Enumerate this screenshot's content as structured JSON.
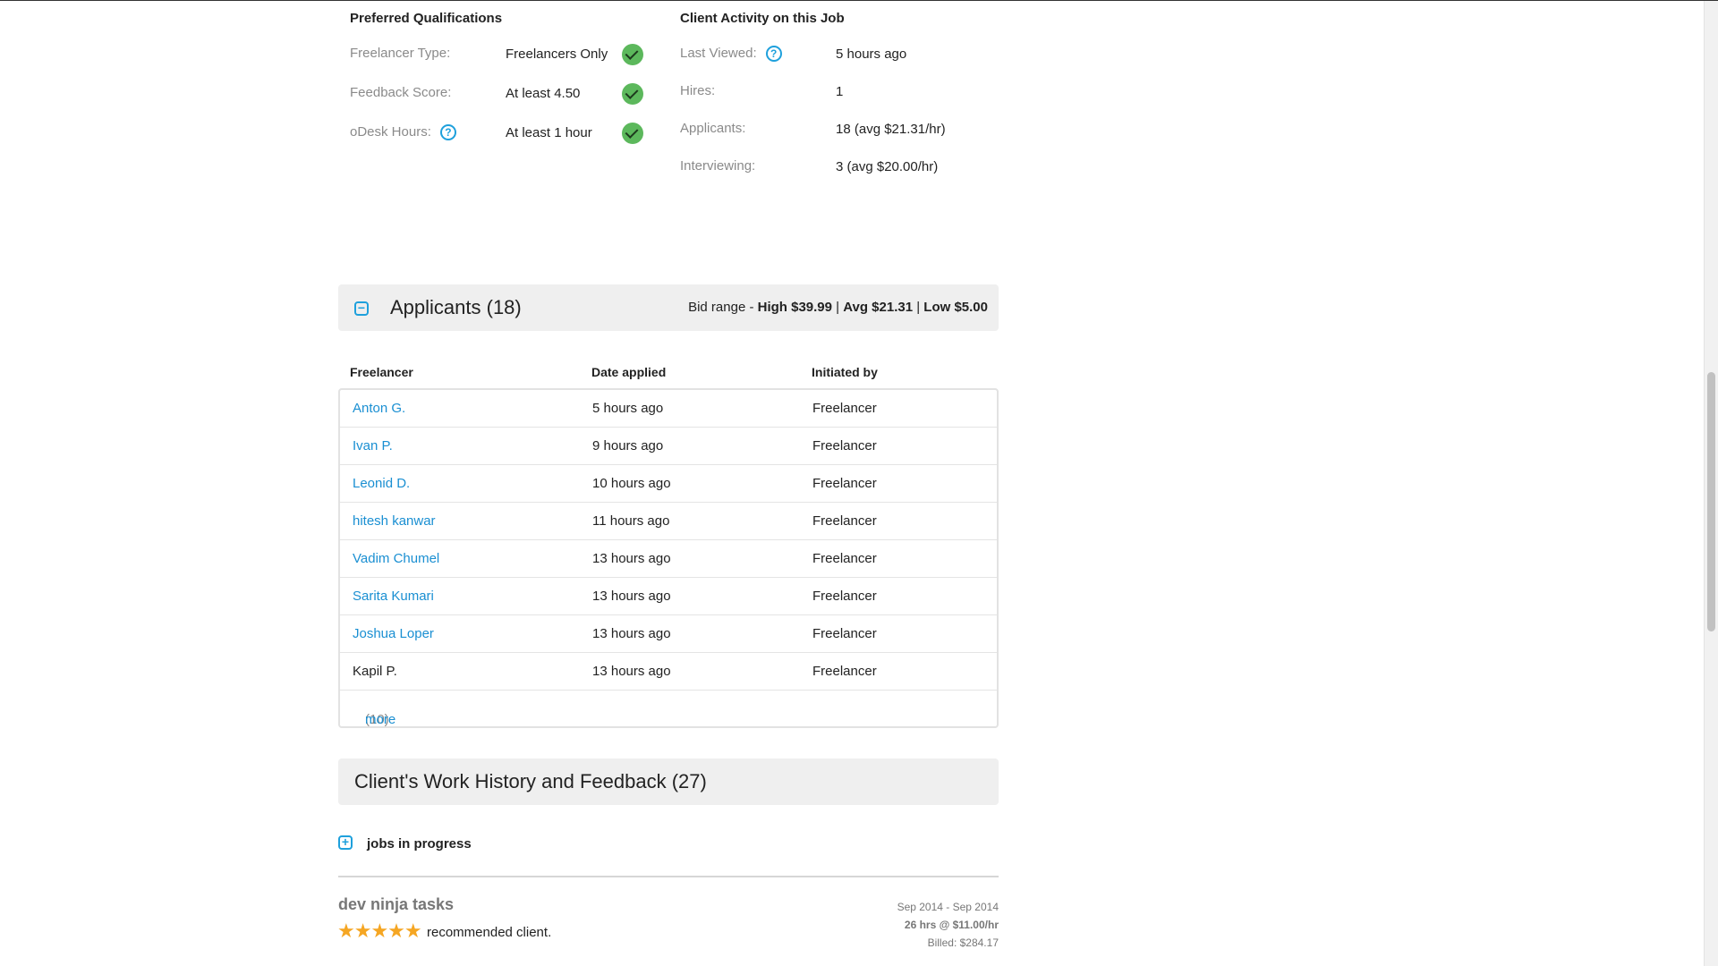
{
  "qualifications": {
    "heading": "Preferred Qualifications",
    "rows": [
      {
        "label": "Freelancer Type:",
        "value": "Freelancers Only",
        "met": true
      },
      {
        "label": "Feedback Score:",
        "value": "At least 4.50",
        "met": true
      },
      {
        "label": "oDesk Hours:",
        "value": "At least 1 hour",
        "met": true
      }
    ]
  },
  "activity": {
    "heading": "Client Activity on this Job",
    "rows": [
      {
        "label": "Last Viewed:",
        "value": "5 hours ago"
      },
      {
        "label": "Hires:",
        "value": "1"
      },
      {
        "label": "Applicants:",
        "value": "18 (avg $21.31/hr)"
      },
      {
        "label": "Interviewing:",
        "value": "3 (avg $20.00/hr)"
      }
    ]
  },
  "applicants": {
    "toggle_glyph": "−",
    "title": "Applicants (18)",
    "bid_prefix": "Bid range - ",
    "high": "High $39.99",
    "sep1": " | ",
    "avg": "Avg $21.31",
    "sep2": " | ",
    "low": "Low $5.00",
    "columns": [
      "Freelancer",
      "Date applied",
      "Initiated by"
    ],
    "rows": [
      {
        "name": "Anton G.",
        "date": "5 hours ago",
        "initiated": "Freelancer",
        "link": true
      },
      {
        "name": "Ivan P.",
        "date": "9 hours ago",
        "initiated": "Freelancer",
        "link": true
      },
      {
        "name": "Leonid D.",
        "date": "10 hours ago",
        "initiated": "Freelancer",
        "link": true
      },
      {
        "name": "hitesh kanwar",
        "date": "11 hours ago",
        "initiated": "Freelancer",
        "link": true
      },
      {
        "name": "Vadim Chumel",
        "date": "13 hours ago",
        "initiated": "Freelancer",
        "link": true
      },
      {
        "name": "Sarita Kumari",
        "date": "13 hours ago",
        "initiated": "Freelancer",
        "link": true
      },
      {
        "name": "Joshua Loper",
        "date": "13 hours ago",
        "initiated": "Freelancer",
        "link": true
      },
      {
        "name": "Kapil P.",
        "date": "13 hours ago",
        "initiated": "Freelancer",
        "link": false
      }
    ],
    "more_count": "(10)",
    "more_label": "more"
  },
  "history": {
    "title": "Client's Work History and Feedback (27)",
    "jobs_toggle_glyph": "+",
    "jobs_label": "jobs in progress",
    "job": {
      "title": "dev ninja tasks",
      "rating": 5,
      "stars": "★★★★★",
      "feedback": "recommended client.",
      "period": "Sep 2014 - Sep 2014",
      "hours": "26 hrs @ $11.00/hr",
      "billed": "Billed: $284.17"
    }
  },
  "colors": {
    "link": "#1a8fd2",
    "check": "#5cb85c",
    "star": "#f5a623",
    "panel_bg": "#efefef"
  },
  "icons": {
    "help": "?"
  }
}
